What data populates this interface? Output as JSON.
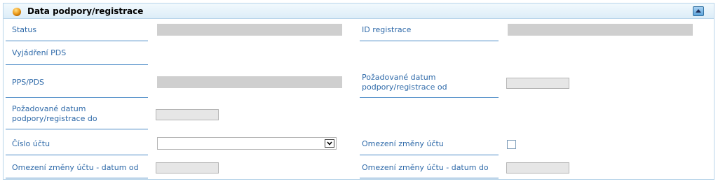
{
  "panel": {
    "title": "Data podpory/registrace",
    "header_icon": "orange-sphere-icon",
    "collapse_icon": "collapse-up-icon"
  },
  "fields": {
    "status_label": "Status",
    "id_registrace_label": "ID registrace",
    "vyjadreni_pds_label": "Vyjádření PDS",
    "pps_pds_label": "PPS/PDS",
    "pozadovane_od_line1": "Požadované datum",
    "pozadovane_od_line2": "podpory/registrace od",
    "pozadovane_do_line1": "Požadované datum",
    "pozadovane_do_line2": "podpory/registrace do",
    "cislo_uctu_label": "Číslo účtu",
    "cislo_uctu_value": "",
    "omezeni_zmeny_uctu_label": "Omezení změny účtu",
    "omezeni_zmeny_uctu_checked": false,
    "omezeni_od_label": "Omezení změny účtu - datum od",
    "omezeni_do_label": "Omezení změny účtu - datum do"
  },
  "colors": {
    "label": "#2f6aa9",
    "underline": "#4a8ac6",
    "header_border": "#b9d5ea",
    "readonly_field": "#cfcfcf"
  }
}
